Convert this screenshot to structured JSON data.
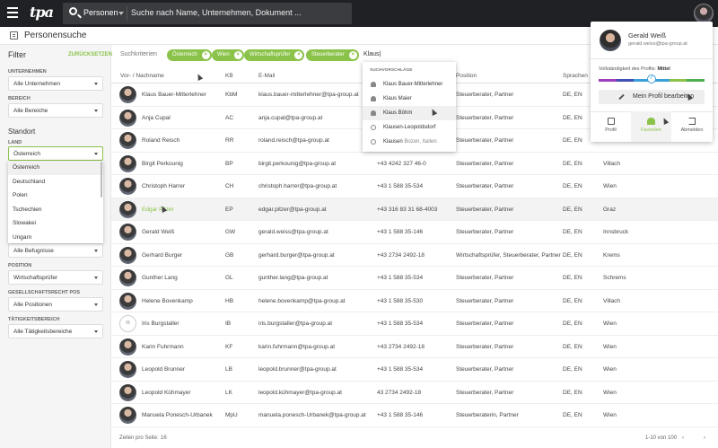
{
  "topbar": {
    "logo": "tpa",
    "scope": "Personen",
    "search_placeholder": "Suche nach Name, Unternehmen, Dokument ..."
  },
  "subheader": {
    "title": "Personensuche"
  },
  "sidebar": {
    "filter_title": "Filter",
    "reset": "ZURÜCKSETZEN",
    "unternehmen_label": "UNTERNEHMEN",
    "unternehmen_value": "Alle Unternehmen",
    "bereich_label": "BEREICH",
    "bereich_value": "Alle Bereiche",
    "standort_title": "Standort",
    "land_label": "LAND",
    "land_value": "Österreich",
    "land_options": [
      "Österreich",
      "Deutschland",
      "Polen",
      "Tschechien",
      "Slowakei",
      "Ungarn"
    ],
    "befugnisse_value": "Alle Befugnisse",
    "position_label": "POSITION",
    "position_value": "Wirtschaftsprüfer",
    "gesellschaftsrecht_label": "GESELLSCHAFTSRECHT POS",
    "gesellschaftsrecht_value": "Alle Positionen",
    "taetigkeit_label": "TÄTIGKEITSBEREICH",
    "taetigkeit_value": "Alle Tätigkeitsbereiche"
  },
  "criteria": {
    "label": "Suchkriterien",
    "chips": [
      "Österreich",
      "Wien",
      "Wirtschaftsprüfer",
      "Steuerberater"
    ],
    "input_value": "Klaus|"
  },
  "suggestions": {
    "header": "SUCHVORSCHLÄGE",
    "items": [
      {
        "icon": "person-icon",
        "text": "Klaus Bauer-Mitterlehner",
        "sub": ""
      },
      {
        "icon": "person-icon",
        "text": "Klaus Maier",
        "sub": ""
      },
      {
        "icon": "person-icon",
        "text": "Klaus Böhm",
        "sub": ""
      },
      {
        "icon": "search-icon",
        "text": "Klausen-Leopoldsdorf",
        "sub": ""
      },
      {
        "icon": "search-icon",
        "text": "Klausen",
        "sub": "Bozen, Italien"
      }
    ]
  },
  "table": {
    "headers": {
      "name": "Vor- / Nachname",
      "kb": "KB",
      "email": "E-Mail",
      "position": "Position",
      "sprachen": "Sprachen"
    },
    "rows": [
      {
        "name": "Klaus Bauer-Mitterlehner",
        "kb": "KbM",
        "email": "klaus.bauer-mitterlehner@tpa-group.at",
        "phone": "",
        "position": "Steuerberater, Partner",
        "sprachen": "DE, EN",
        "ort": ""
      },
      {
        "name": "Anja Cupal",
        "kb": "AC",
        "email": "anja.cupal@tpa-group.at",
        "phone": "",
        "position": "Steuerberater, Partner",
        "sprachen": "DE, EN",
        "ort": ""
      },
      {
        "name": "Roland Reisch",
        "kb": "RR",
        "email": "roland.reisch@tpa-group.at",
        "phone": "",
        "position": "Steuerberater, Partner",
        "sprachen": "DE, EN",
        "ort": ""
      },
      {
        "name": "Birgit Perkounig",
        "kb": "BP",
        "email": "birgit.perkounig@tpa-group.at",
        "phone": "+43 4242 327 46-0",
        "position": "Steuerberater, Partner",
        "sprachen": "DE, EN",
        "ort": "Villach"
      },
      {
        "name": "Christoph Harrer",
        "kb": "CH",
        "email": "christoph.harrer@tpa-group.at",
        "phone": "+43 1 588 35-534",
        "position": "Steuerberater, Partner",
        "sprachen": "DE, EN",
        "ort": "Wien"
      },
      {
        "name": "Edgar Pitzer",
        "kb": "EP",
        "email": "edgar.pitzer@tpa-group.at",
        "phone": "+43 316 83 31 68-4003",
        "position": "Steuerberater, Partner",
        "sprachen": "DE, EN",
        "ort": "Graz"
      },
      {
        "name": "Gerald Weiß",
        "kb": "GW",
        "email": "gerald.weiss@tpa-group.at",
        "phone": "+43 1 588 35-146",
        "position": "Steuerberater, Partner",
        "sprachen": "DE, EN",
        "ort": "Innsbruck"
      },
      {
        "name": "Gerhard Burger",
        "kb": "GB",
        "email": "gerhard.burger@tpa-group.at",
        "phone": "+43 2734 2492-18",
        "position": "Wirtschaftsprüfer, Steuerberater, Partner",
        "sprachen": "DE, EN",
        "ort": "Krems"
      },
      {
        "name": "Gunther Lang",
        "kb": "GL",
        "email": "gunther.lang@tpa-group.at",
        "phone": "+43 1 588 35-534",
        "position": "Steuerberater, Partner",
        "sprachen": "DE, EN",
        "ort": "Schrems"
      },
      {
        "name": "Helene Bovenkamp",
        "kb": "HB",
        "email": "helene.bovenkamp@tpa-group.at",
        "phone": "+43 1 588 35-530",
        "position": "Steuerberater, Partner",
        "sprachen": "DE, EN",
        "ort": "Villach"
      },
      {
        "name": "Iris Burgstaller",
        "kb": "IB",
        "email": "iris.burgstaller@tpa-group.at",
        "phone": "+43 1 588 35-534",
        "position": "Steuerberater, Partner",
        "sprachen": "DE, EN",
        "ort": "Wien",
        "initials": "IB"
      },
      {
        "name": "Karin Fuhrmann",
        "kb": "KF",
        "email": "karin.fuhrmann@tpa-group.at",
        "phone": "+43 2734 2492-18",
        "position": "Steuerberater, Partner",
        "sprachen": "DE, EN",
        "ort": "Wien"
      },
      {
        "name": "Leopold Brunner",
        "kb": "LB",
        "email": "leopold.brunner@tpa-group.at",
        "phone": "+43 1 588 35-534",
        "position": "Steuerberater, Partner",
        "sprachen": "DE, EN",
        "ort": "Wien"
      },
      {
        "name": "Leopold Kühmayer",
        "kb": "LK",
        "email": "leopold.kühmayer@tpa-group.at",
        "phone": "43 2734 2492-18",
        "position": "Steuerberater, Partner",
        "sprachen": "DE, EN",
        "ort": "Wien"
      },
      {
        "name": "Manuela Ponesch-Urbanek",
        "kb": "MpU",
        "email": "manuela.ponesch-Urbanek@tpa-group.at",
        "phone": "+43 1 588 35-146",
        "position": "Steuerberaterin, Partner",
        "sprachen": "DE, EN",
        "ort": "Wien"
      }
    ]
  },
  "footer": {
    "per_page_label": "Zeilen pro Seite:",
    "per_page_value": "16",
    "range": "1-10 von 100"
  },
  "profile": {
    "name": "Gerald Weiß",
    "email": "gerald.weiss@tpa-group.at",
    "completeness_label": "Vollständigkeit des Profils:",
    "completeness_value": "Mittel",
    "edit_button": "Mein Profil bearbeiten",
    "tabs": [
      "Profil",
      "Favoriten",
      "Abmelden"
    ]
  },
  "colors": {
    "accent": "#8bc34a",
    "topbar": "#1f2124"
  }
}
